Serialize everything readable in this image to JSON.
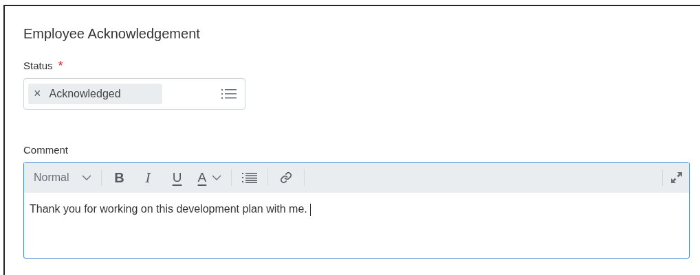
{
  "section": {
    "title": "Employee Acknowledgement"
  },
  "status": {
    "label": "Status",
    "required_mark": "*",
    "values": [
      {
        "label": "Acknowledged",
        "remove": "×"
      }
    ]
  },
  "comment": {
    "label": "Comment",
    "focused": true,
    "toolbar": {
      "format": "Normal",
      "tools": [
        {
          "kind": "bold",
          "glyph": "B"
        },
        {
          "kind": "italic",
          "glyph": "I"
        },
        {
          "kind": "underline",
          "glyph": "U"
        },
        {
          "kind": "color",
          "glyph": "A"
        },
        {
          "kind": "list"
        },
        {
          "kind": "link"
        }
      ]
    },
    "value": "Thank you for working on this development plan with me."
  }
}
